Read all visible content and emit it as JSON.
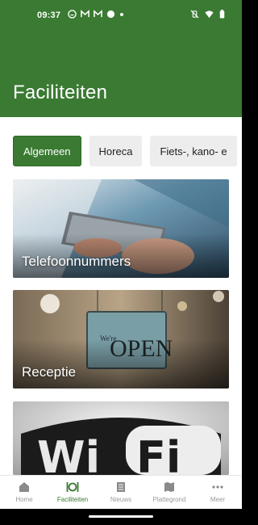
{
  "status_bar": {
    "time": "09:37",
    "left_icons": [
      "smiley-icon",
      "gmail-icon",
      "gmail-icon",
      "dot-icon",
      "small-dot-icon"
    ],
    "right_icons": [
      "vibrate-off-icon",
      "wifi-icon",
      "battery-icon"
    ]
  },
  "header": {
    "title": "Faciliteiten",
    "color": "#3a7a32"
  },
  "chips": [
    {
      "label": "Algemeen",
      "active": true
    },
    {
      "label": "Horeca",
      "active": false
    },
    {
      "label": "Fiets-, kano- e",
      "active": false
    }
  ],
  "cards": [
    {
      "label": "Telefoonnummers",
      "image": "phone-in-hand-photo"
    },
    {
      "label": "Receptie",
      "image": "open-sign-photo"
    },
    {
      "label": "",
      "image": "wifi-sign-photo",
      "sign_text": [
        "Wi",
        "Fi"
      ]
    }
  ],
  "bottom_nav": {
    "items": [
      {
        "label": "Home",
        "icon": "home-icon",
        "active": false
      },
      {
        "label": "Faciliteiten",
        "icon": "cutlery-icon",
        "active": true
      },
      {
        "label": "Nieuws",
        "icon": "news-icon",
        "active": false
      },
      {
        "label": "Plattegrond",
        "icon": "map-icon",
        "active": false
      },
      {
        "label": "Meer",
        "icon": "more-icon",
        "active": false
      }
    ]
  }
}
